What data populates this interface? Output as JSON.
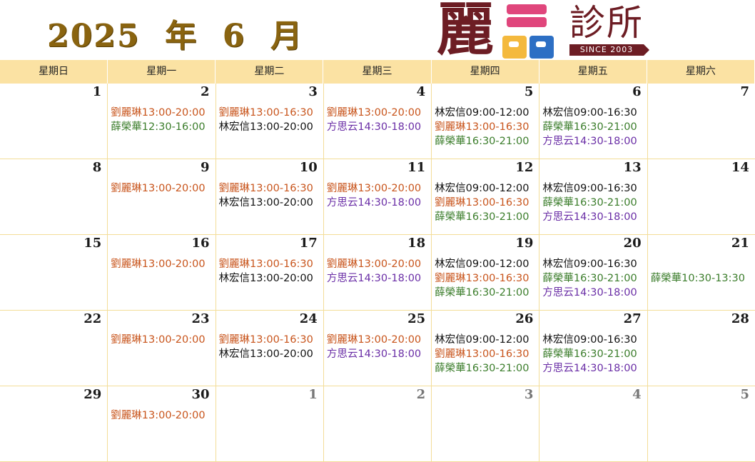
{
  "title": "2025  年  6  月",
  "logo": {
    "char": "麗",
    "clinic": "診所",
    "since": "SINCE 2003",
    "colors": {
      "maroon": "#6d1d24",
      "pink": "#e0467c",
      "yellow": "#f4b93d",
      "blue": "#2d6fc4"
    }
  },
  "colors": {
    "header_bg": "#fbe2a3",
    "grid_line": "#f3dd98",
    "orange": "#c8541b",
    "green": "#3b7d2b",
    "purple": "#6a2ea6",
    "black": "#111111"
  },
  "weekdays": [
    "星期日",
    "星期一",
    "星期二",
    "星期三",
    "星期四",
    "星期五",
    "星期六"
  ],
  "weeks": [
    [
      {
        "day": "1",
        "entries": []
      },
      {
        "day": "2",
        "entries": [
          {
            "text": "劉麗琳13:00-20:00",
            "color": "orange"
          },
          {
            "text": "薛榮華12:30-16:00",
            "color": "green"
          }
        ]
      },
      {
        "day": "3",
        "entries": [
          {
            "text": "劉麗琳13:00-16:30",
            "color": "orange"
          },
          {
            "text": "林宏信13:00-20:00",
            "color": "black"
          }
        ]
      },
      {
        "day": "4",
        "entries": [
          {
            "text": "劉麗琳13:00-20:00",
            "color": "orange"
          },
          {
            "text": "方思云14:30-18:00",
            "color": "purple"
          }
        ]
      },
      {
        "day": "5",
        "entries": [
          {
            "text": "林宏信09:00-12:00",
            "color": "black"
          },
          {
            "text": "劉麗琳13:00-16:30",
            "color": "orange"
          },
          {
            "text": "薛榮華16:30-21:00",
            "color": "green"
          }
        ]
      },
      {
        "day": "6",
        "entries": [
          {
            "text": "林宏信09:00-16:30",
            "color": "black"
          },
          {
            "text": "薛榮華16:30-21:00",
            "color": "green"
          },
          {
            "text": "方思云14:30-18:00",
            "color": "purple"
          }
        ]
      },
      {
        "day": "7",
        "entries": []
      }
    ],
    [
      {
        "day": "8",
        "entries": []
      },
      {
        "day": "9",
        "entries": [
          {
            "text": "劉麗琳13:00-20:00",
            "color": "orange"
          }
        ]
      },
      {
        "day": "10",
        "entries": [
          {
            "text": "劉麗琳13:00-16:30",
            "color": "orange"
          },
          {
            "text": "林宏信13:00-20:00",
            "color": "black"
          }
        ]
      },
      {
        "day": "11",
        "entries": [
          {
            "text": "劉麗琳13:00-20:00",
            "color": "orange"
          },
          {
            "text": "方思云14:30-18:00",
            "color": "purple"
          }
        ]
      },
      {
        "day": "12",
        "entries": [
          {
            "text": "林宏信09:00-12:00",
            "color": "black"
          },
          {
            "text": "劉麗琳13:00-16:30",
            "color": "orange"
          },
          {
            "text": "薛榮華16:30-21:00",
            "color": "green"
          }
        ]
      },
      {
        "day": "13",
        "entries": [
          {
            "text": "林宏信09:00-16:30",
            "color": "black"
          },
          {
            "text": "薛榮華16:30-21:00",
            "color": "green"
          },
          {
            "text": "方思云14:30-18:00",
            "color": "purple"
          }
        ]
      },
      {
        "day": "14",
        "entries": []
      }
    ],
    [
      {
        "day": "15",
        "entries": []
      },
      {
        "day": "16",
        "entries": [
          {
            "text": "劉麗琳13:00-20:00",
            "color": "orange"
          }
        ]
      },
      {
        "day": "17",
        "entries": [
          {
            "text": "劉麗琳13:00-16:30",
            "color": "orange"
          },
          {
            "text": "林宏信13:00-20:00",
            "color": "black"
          }
        ]
      },
      {
        "day": "18",
        "entries": [
          {
            "text": "劉麗琳13:00-20:00",
            "color": "orange"
          },
          {
            "text": "方思云14:30-18:00",
            "color": "purple"
          }
        ]
      },
      {
        "day": "19",
        "entries": [
          {
            "text": "林宏信09:00-12:00",
            "color": "black"
          },
          {
            "text": "劉麗琳13:00-16:30",
            "color": "orange"
          },
          {
            "text": "薛榮華16:30-21:00",
            "color": "green"
          }
        ]
      },
      {
        "day": "20",
        "entries": [
          {
            "text": "林宏信09:00-16:30",
            "color": "black"
          },
          {
            "text": "薛榮華16:30-21:00",
            "color": "green"
          },
          {
            "text": "方思云14:30-18:00",
            "color": "purple"
          }
        ]
      },
      {
        "day": "21",
        "entries": [
          {
            "text": "",
            "color": "black"
          },
          {
            "text": "薛榮華10:30-13:30",
            "color": "green"
          }
        ]
      }
    ],
    [
      {
        "day": "22",
        "entries": []
      },
      {
        "day": "23",
        "entries": [
          {
            "text": "劉麗琳13:00-20:00",
            "color": "orange"
          }
        ]
      },
      {
        "day": "24",
        "entries": [
          {
            "text": "劉麗琳13:00-16:30",
            "color": "orange"
          },
          {
            "text": "林宏信13:00-20:00",
            "color": "black"
          }
        ]
      },
      {
        "day": "25",
        "entries": [
          {
            "text": "劉麗琳13:00-20:00",
            "color": "orange"
          },
          {
            "text": "方思云14:30-18:00",
            "color": "purple"
          }
        ]
      },
      {
        "day": "26",
        "entries": [
          {
            "text": "林宏信09:00-12:00",
            "color": "black"
          },
          {
            "text": "劉麗琳13:00-16:30",
            "color": "orange"
          },
          {
            "text": "薛榮華16:30-21:00",
            "color": "green"
          }
        ]
      },
      {
        "day": "27",
        "entries": [
          {
            "text": "林宏信09:00-16:30",
            "color": "black"
          },
          {
            "text": "薛榮華16:30-21:00",
            "color": "green"
          },
          {
            "text": "方思云14:30-18:00",
            "color": "purple"
          }
        ]
      },
      {
        "day": "28",
        "entries": []
      }
    ],
    [
      {
        "day": "29",
        "entries": []
      },
      {
        "day": "30",
        "entries": [
          {
            "text": "劉麗琳13:00-20:00",
            "color": "orange"
          }
        ]
      },
      {
        "day": "1",
        "other": true,
        "entries": []
      },
      {
        "day": "2",
        "other": true,
        "entries": []
      },
      {
        "day": "3",
        "other": true,
        "entries": []
      },
      {
        "day": "4",
        "other": true,
        "entries": []
      },
      {
        "day": "5",
        "other": true,
        "entries": []
      }
    ]
  ]
}
